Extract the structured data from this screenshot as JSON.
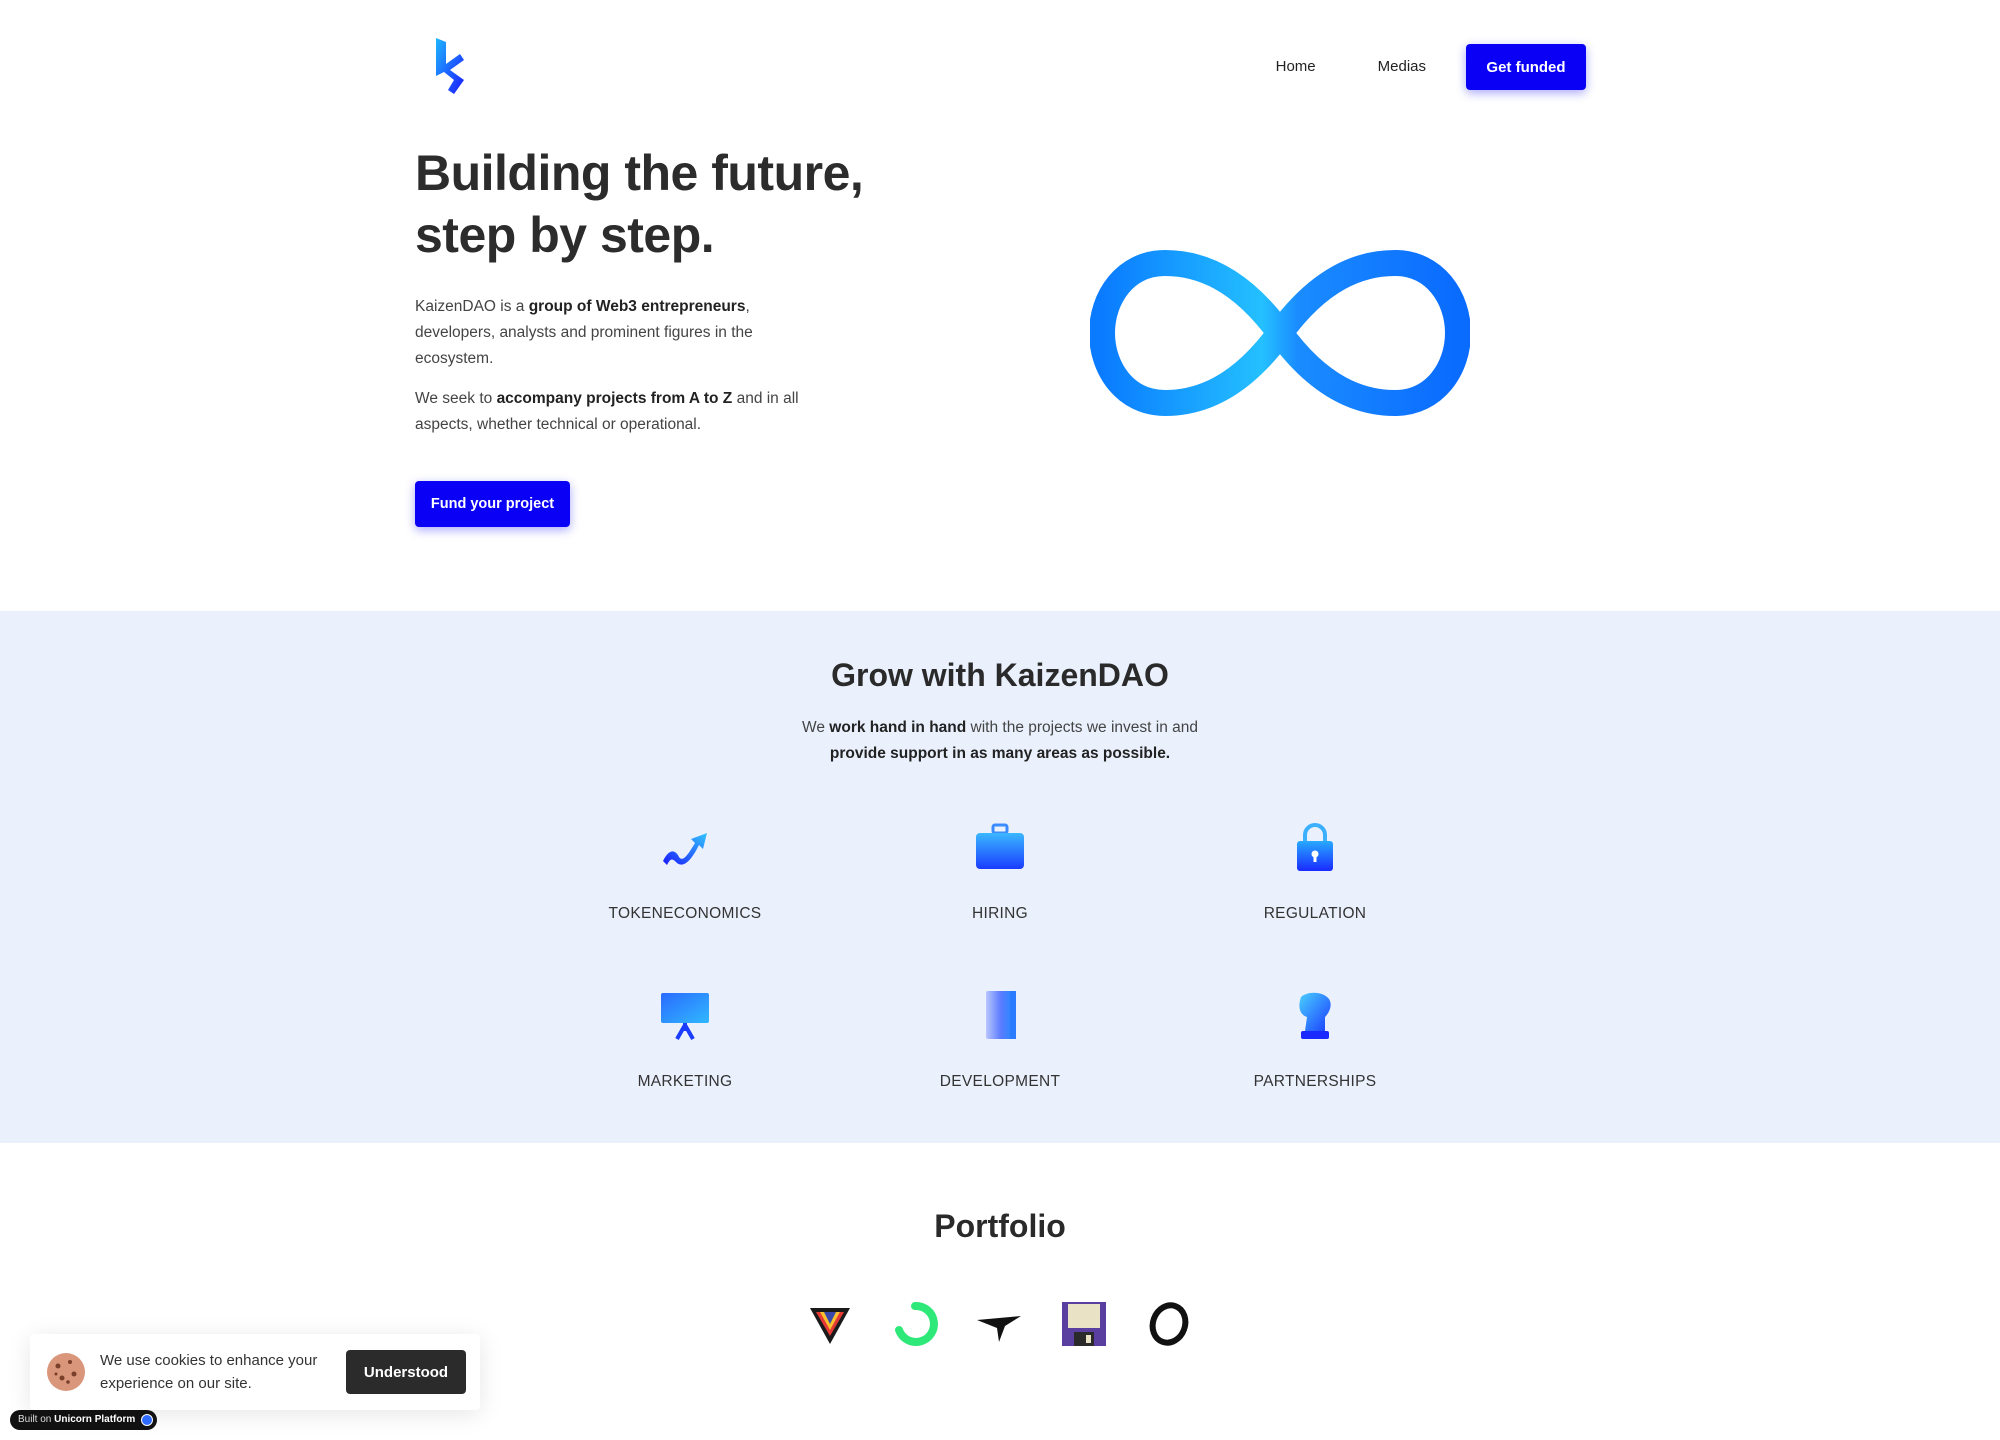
{
  "header": {
    "logo": "kaizendao-logo",
    "nav": {
      "home": "Home",
      "medias": "Medias",
      "cta": "Get funded"
    }
  },
  "hero": {
    "title_line1": "Building the future,",
    "title_line2": "step by step.",
    "p1_a": "KaizenDAO is a ",
    "p1_b": "group of Web3 entrepreneurs",
    "p1_c": ", developers, analysts and prominent figures in the ecosystem.",
    "p2_a": "We seek to ",
    "p2_b": "accompany projects from A to Z",
    "p2_c": " and in all aspects, whether technical or operational.",
    "cta": "Fund your project"
  },
  "grow": {
    "title": "Grow with KaizenDAO",
    "sub_a": "We ",
    "sub_b": "work hand in hand",
    "sub_c": " with the projects we invest in and ",
    "sub_d": "provide support in as many areas as possible.",
    "features": [
      {
        "label": "TOKENECONOMICS",
        "icon": "trend-icon"
      },
      {
        "label": "HIRING",
        "icon": "briefcase-icon"
      },
      {
        "label": "REGULATION",
        "icon": "lock-icon"
      },
      {
        "label": "MARKETING",
        "icon": "presentation-board-icon"
      },
      {
        "label": "DEVELOPMENT",
        "icon": "book-icon"
      },
      {
        "label": "PARTNERSHIPS",
        "icon": "chess-piece-icon"
      }
    ]
  },
  "portfolio": {
    "title": "Portfolio",
    "logos": [
      "triangle-logo",
      "green-ring-logo",
      "bird-logo",
      "floppy-logo",
      "black-ring-logo"
    ]
  },
  "cookie": {
    "text": "We use cookies to enhance your experience on our site.",
    "button": "Understood"
  },
  "badge": {
    "prefix": "Built on ",
    "brand": "Unicorn Platform"
  },
  "colors": {
    "primary": "#0a00f5",
    "section_bg": "#eaf1fd",
    "text": "#2b2b2b"
  }
}
